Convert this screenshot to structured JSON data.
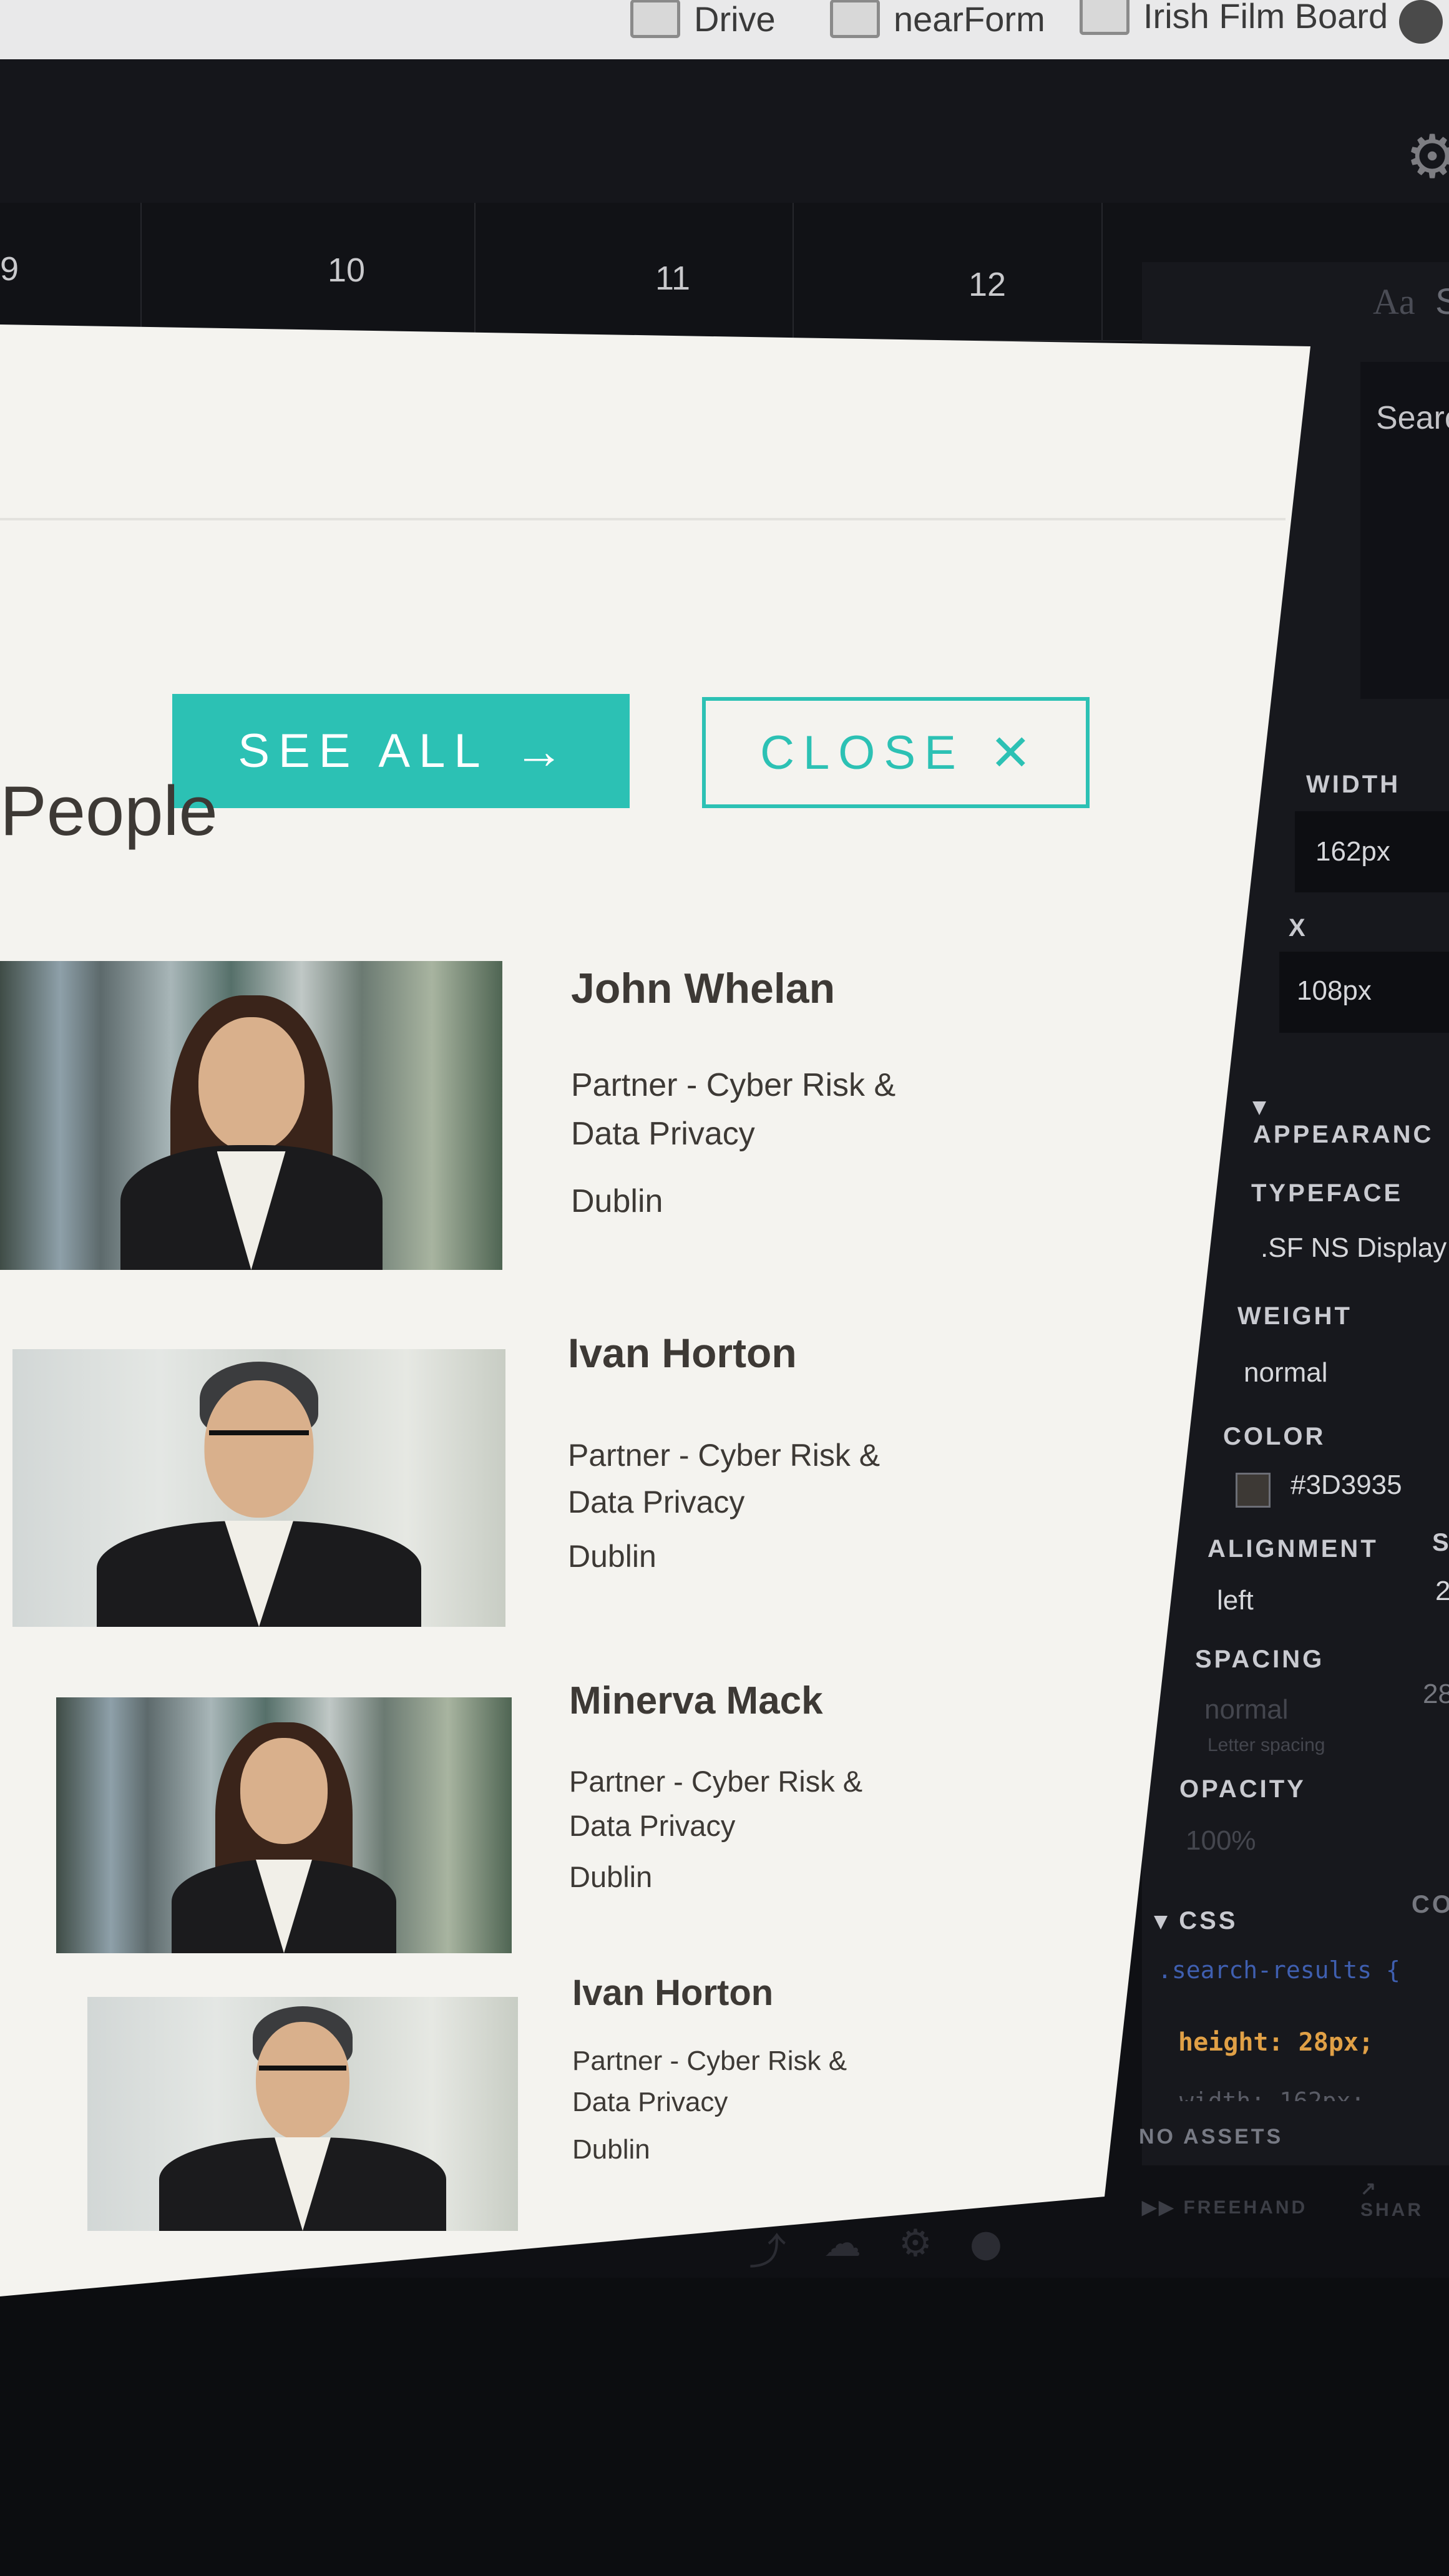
{
  "bookmarks": [
    {
      "label": "Drive"
    },
    {
      "label": "nearForm"
    },
    {
      "label": "Irish Film Board"
    }
  ],
  "ruler": {
    "numbers": [
      "9",
      "10",
      "11",
      "12"
    ]
  },
  "inspector": {
    "font_preview": "Aa",
    "font_preview_cut": "S",
    "search_label": "Searc",
    "width_label": "WIDTH",
    "width_value": "162px",
    "x_label": "X",
    "x_value": "108px",
    "appearance_label": "APPEARANC",
    "typeface_label": "TYPEFACE",
    "typeface_value": ".SF NS Display",
    "weight_label": "WEIGHT",
    "weight_value": "normal",
    "color_label": "COLOR",
    "color_value": "#3D3935",
    "alignment_label": "ALIGNMENT",
    "alignment_value": "left",
    "alignment_extra_label": "S",
    "alignment_extra_value": "2",
    "spacing_label": "SPACING",
    "spacing_value": "normal",
    "spacing_hint": "Letter spacing",
    "spacing_extra_value": "28",
    "opacity_label": "OPACITY",
    "opacity_value": "100%",
    "css_label": "CSS",
    "css_extra_label": "CO",
    "css_selector": ".search-results {",
    "css_line": "height: 28px;",
    "css_line_cut": "width: 162px;",
    "no_assets": "NO ASSETS",
    "freehand": "FREEHAND",
    "share": "SHAR",
    "accent_color": "#2cc1b4"
  },
  "card": {
    "see_all_label": "SEE ALL",
    "see_all_icon": "arrow-right-icon",
    "close_label": "CLOSE",
    "close_icon": "close-icon",
    "section_title": "People",
    "people": [
      {
        "name": "John Whelan",
        "role_line1": "Partner - Cyber Risk &",
        "role_line2": "Data Privacy",
        "location": "Dublin"
      },
      {
        "name": "Ivan Horton",
        "role_line1": "Partner - Cyber Risk &",
        "role_line2": "Data Privacy",
        "location": "Dublin"
      },
      {
        "name": "Minerva Mack",
        "role_line1": "Partner - Cyber Risk &",
        "role_line2": "Data Privacy",
        "location": "Dublin"
      },
      {
        "name": "Ivan Horton",
        "role_line1": "Partner - Cyber Risk &",
        "role_line2": "Data Privacy",
        "location": "Dublin"
      }
    ]
  }
}
